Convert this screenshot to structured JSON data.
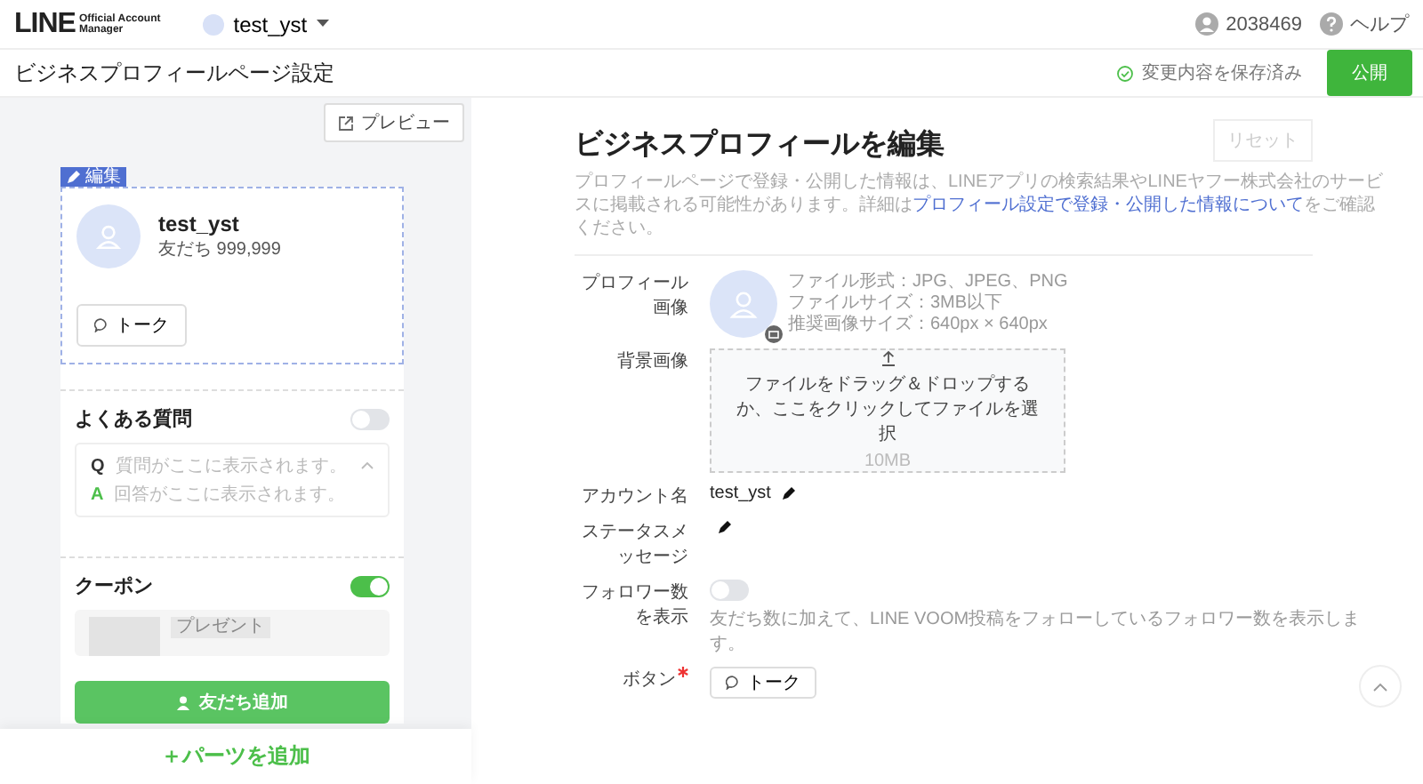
{
  "header": {
    "logo": "LINE",
    "logo_sub": [
      "Official Account",
      "Manager"
    ],
    "account": "test_yst",
    "user_id": "2038469",
    "help": "ヘルプ"
  },
  "subheader": {
    "title": "ビジネスプロフィールページ設定",
    "save_status": "変更内容を保存済み",
    "publish_button": "公開"
  },
  "preview": {
    "button": "プレビュー",
    "edit_tag": "編集",
    "profile": {
      "name": "test_yst",
      "friends": "友だち 999,999",
      "talk_button": "トーク"
    },
    "sections": [
      {
        "kind": "faq",
        "title": "よくある質問",
        "on": false,
        "question_mark": "Q",
        "question": "質問がここに表示されます。",
        "answer_mark": "A",
        "answer": "回答がここに表示されます。"
      },
      {
        "kind": "coupon",
        "title": "クーポン",
        "on": true,
        "tag": "プレゼント"
      }
    ],
    "add_friend_button": "友だち追加",
    "add_parts": "＋パーツを追加"
  },
  "editor": {
    "title": "ビジネスプロフィールを編集",
    "reset_button": "リセット",
    "description_before": "プロフィールページで登録・公開した情報は、LINEアプリの検索結果やLINEヤフー株式会社のサービスに掲載される可能性があります。詳細は",
    "description_link": "プロフィール設定で登録・公開した情報について",
    "description_after": "をご確認ください。",
    "fields": [
      {
        "kind": "image",
        "label": "プロフィール画像",
        "info": [
          "ファイル形式：JPG、JPEG、PNG",
          "ファイルサイズ：3MB以下",
          "推奨画像サイズ：640px × 640px"
        ]
      },
      {
        "kind": "upload",
        "label": "背景画像",
        "text": "ファイルをドラッグ＆ドロップするか、ここをクリックしてファイルを選択",
        "size": "10MB"
      },
      {
        "kind": "editable",
        "label": "アカウント名",
        "value": "test_yst"
      },
      {
        "kind": "editable",
        "label": "ステータスメッセージ"
      },
      {
        "kind": "toggle",
        "label": "フォロワー数を表示",
        "on": false,
        "note": "友だち数に加えて、LINE VOOM投稿をフォローしているフォロワー数を表示します。"
      },
      {
        "kind": "button",
        "label": "ボタン",
        "required": true,
        "value": "トーク"
      }
    ]
  }
}
